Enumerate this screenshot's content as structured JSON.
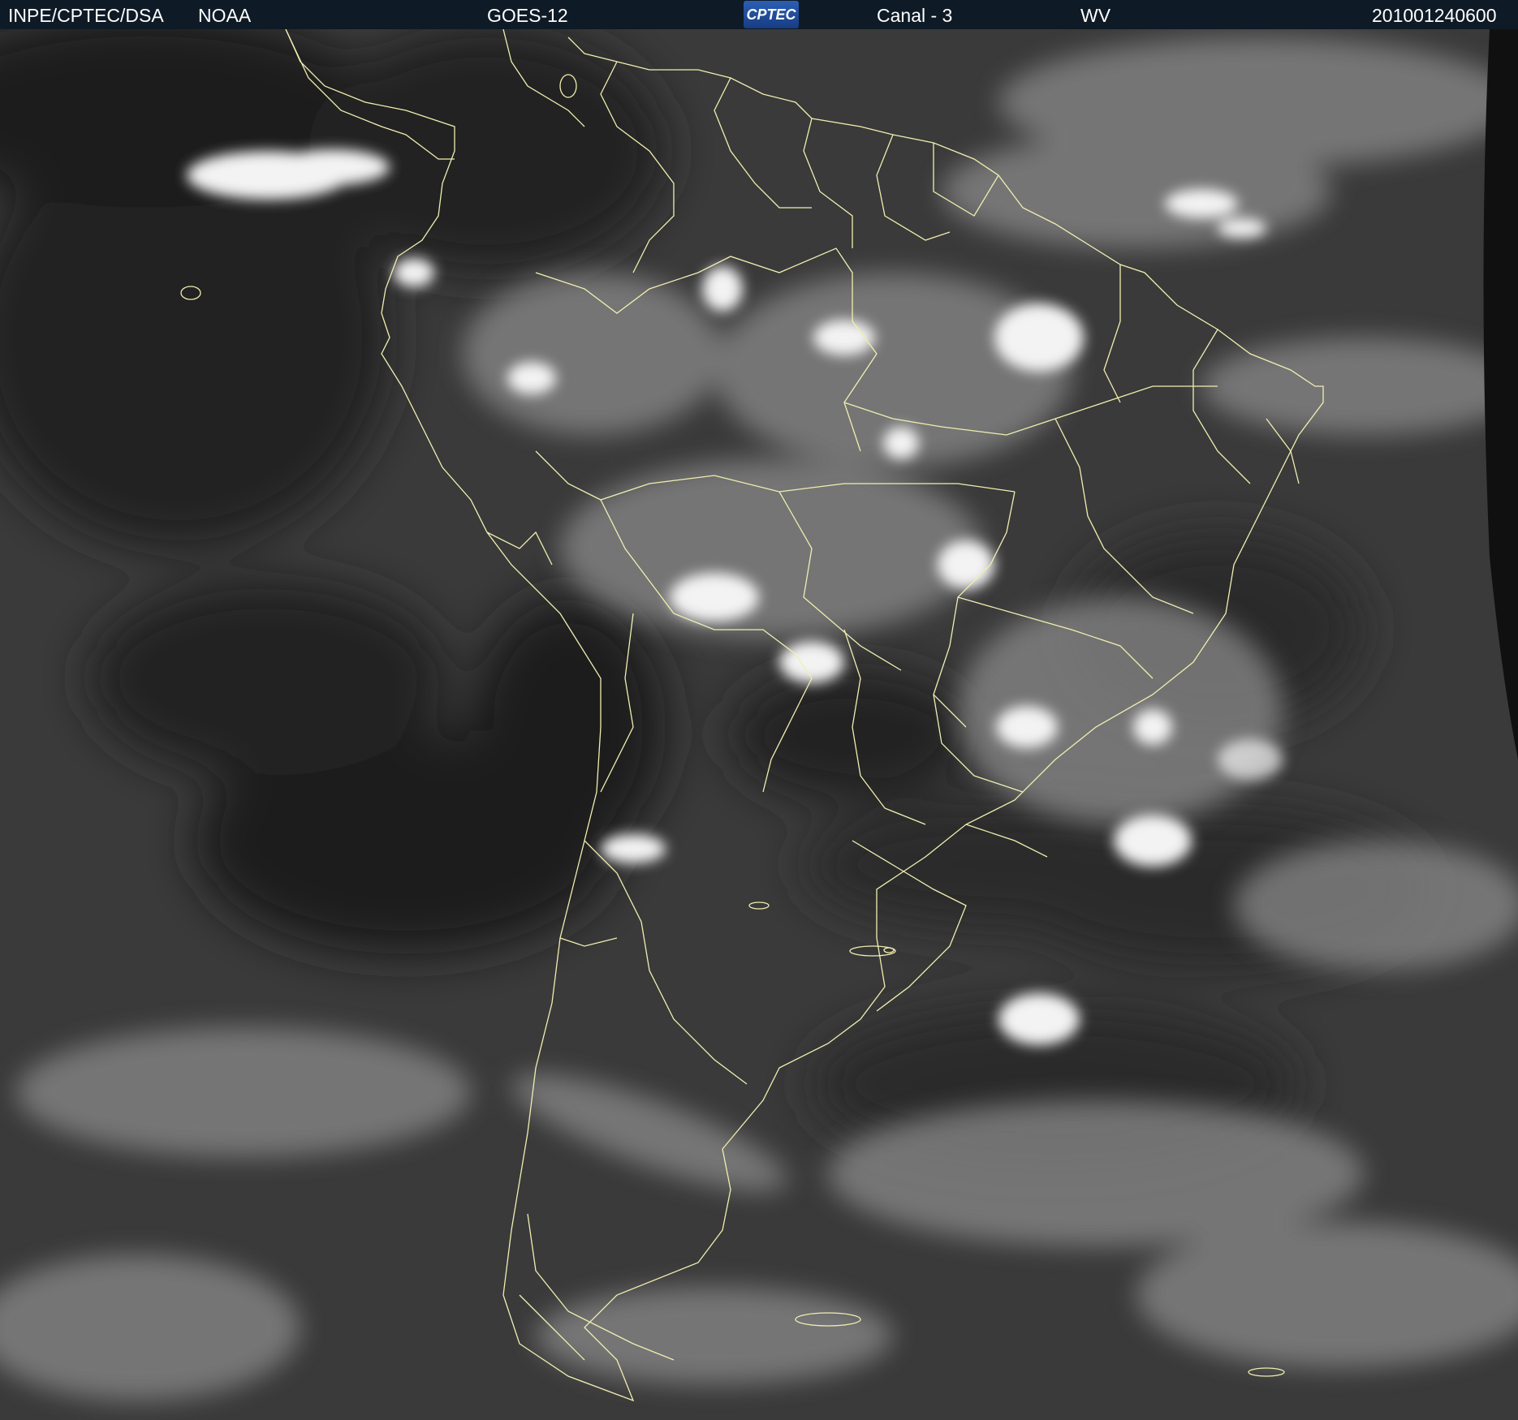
{
  "header": {
    "institution": "INPE/CPTEC/DSA",
    "agency": "NOAA",
    "satellite": "GOES-12",
    "logo_text": "CPTEC",
    "channel": "Canal - 3",
    "band": "WV",
    "timestamp": "201001240600"
  },
  "map": {
    "image_type": "water vapor satellite imagery",
    "region": "South America",
    "border_color": "#f0efb0",
    "background_color": "#3c3c3c",
    "cloud_color": "#f2f2f2"
  }
}
